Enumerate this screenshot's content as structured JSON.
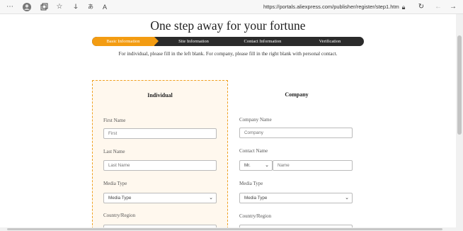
{
  "browser": {
    "url": "https://portals.aliexpress.com/publisher/register/step1.htm"
  },
  "page": {
    "title": "One step away for your fortune",
    "steps": [
      {
        "label": "Basic Information",
        "active": true
      },
      {
        "label": "Site Information",
        "active": false
      },
      {
        "label": "Contact Information",
        "active": false
      },
      {
        "label": "Verification",
        "active": false
      }
    ],
    "instruction": "For individual, please fill in the left blank. For company, please fill in the right blank with personal contact."
  },
  "individual": {
    "title": "Individual",
    "first_name_label": "First Name",
    "first_name_placeholder": "First",
    "last_name_label": "Last Name",
    "last_name_placeholder": "Last Name",
    "media_type_label": "Media Type",
    "media_type_value": "Media Type",
    "country_label": "Country/Region"
  },
  "company": {
    "title": "Company",
    "company_name_label": "Company Name",
    "company_name_placeholder": "Company",
    "contact_name_label": "Contact Name",
    "salutation_value": "Mr.",
    "name_placeholder": "Name",
    "media_type_label": "Media Type",
    "media_type_value": "Media Type",
    "country_label": "Country/Region"
  },
  "colors": {
    "accent": "#f39c12",
    "step_bar": "#2b2b2b",
    "panel_bg": "#fff8ee"
  }
}
